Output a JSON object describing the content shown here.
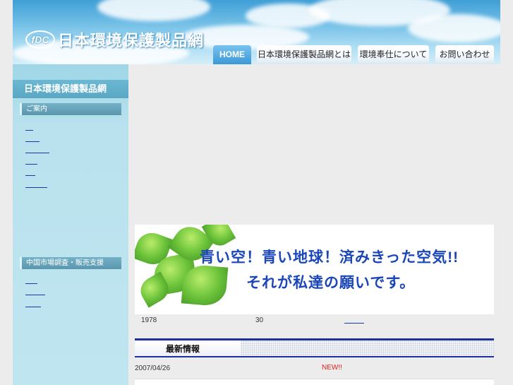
{
  "header": {
    "logo_mark": "fDC",
    "site_name": "日本環境保護製品網"
  },
  "nav": {
    "tabs": [
      {
        "label": "HOME"
      },
      {
        "label": "日本環境保護製品網とは"
      },
      {
        "label": "環境奉仕について"
      },
      {
        "label": "お問い合わせ"
      }
    ]
  },
  "sidebar": {
    "title": "日本環境保護製品網",
    "sections": [
      {
        "heading": "ご案内",
        "link_count": 6
      },
      {
        "heading": "中国市場調査・販売支援",
        "link_count": 3
      }
    ]
  },
  "main": {
    "banner": {
      "line1": "青い空！青い地球！済みきった空気!!",
      "line2": "それが私達の願いです。"
    },
    "info": {
      "year": "1978",
      "number": "30"
    },
    "news": {
      "title": "最新情報",
      "items": [
        {
          "date": "2007/04/26",
          "badge": "NEW!!"
        }
      ]
    }
  },
  "colors": {
    "accent": "#1e2f9e",
    "sky": "#6fbde6",
    "sidebar": "#bfe5f0",
    "new_badge": "#e0201a"
  }
}
